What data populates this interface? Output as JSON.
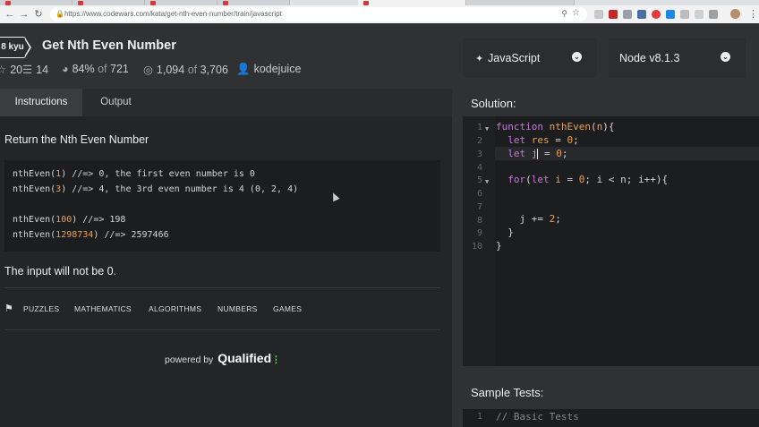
{
  "browser": {
    "url": "https://www.codewars.com/kata/get-nth-even-number/train/javascript"
  },
  "kata": {
    "rank": "8 kyu",
    "title": "Get Nth Even Number",
    "stars": "20",
    "collections": "14",
    "satisfaction_pct": "84%",
    "satisfaction_of": "of",
    "satisfaction_votes": "721",
    "completed": "1,094",
    "completed_of": "of",
    "attempts": "3,706",
    "author": "kodejuice"
  },
  "tabs": {
    "instructions": "Instructions",
    "output": "Output"
  },
  "instructions": {
    "heading": "Return the Nth Even Number",
    "examples": [
      {
        "fn": "nthEven(",
        "arg": "1",
        "rest": ") //=> 0, the first even number is 0"
      },
      {
        "fn": "nthEven(",
        "arg": "3",
        "rest": ") //=> 4, the 3rd even number is 4 (0, 2, 4)"
      },
      {
        "fn": "nthEven(",
        "arg": "100",
        "rest": ") //=> 198"
      },
      {
        "fn": "nthEven(",
        "arg": "1298734",
        "rest": ") //=> 2597466"
      }
    ],
    "note": "The input will not be 0.",
    "tags": [
      "PUZZLES",
      "MATHEMATICS",
      "ALGORITHMS",
      "NUMBERS",
      "GAMES"
    ],
    "powered_by": "powered by",
    "brand": "Qualified"
  },
  "selectors": {
    "language": "JavaScript",
    "runtime": "Node v8.1.3"
  },
  "solution": {
    "heading": "Solution:",
    "line_numbers": [
      "1",
      "2",
      "3",
      "4",
      "5",
      "6",
      "7",
      "8",
      "9",
      "10"
    ]
  },
  "tests": {
    "heading": "Sample Tests:",
    "line1_number": "1",
    "line1": "// Basic Tests"
  },
  "colors": {
    "accent_orange": "#e8a05b",
    "keyword_purple": "#c678dd",
    "qualified_green": "#5fd35f"
  }
}
